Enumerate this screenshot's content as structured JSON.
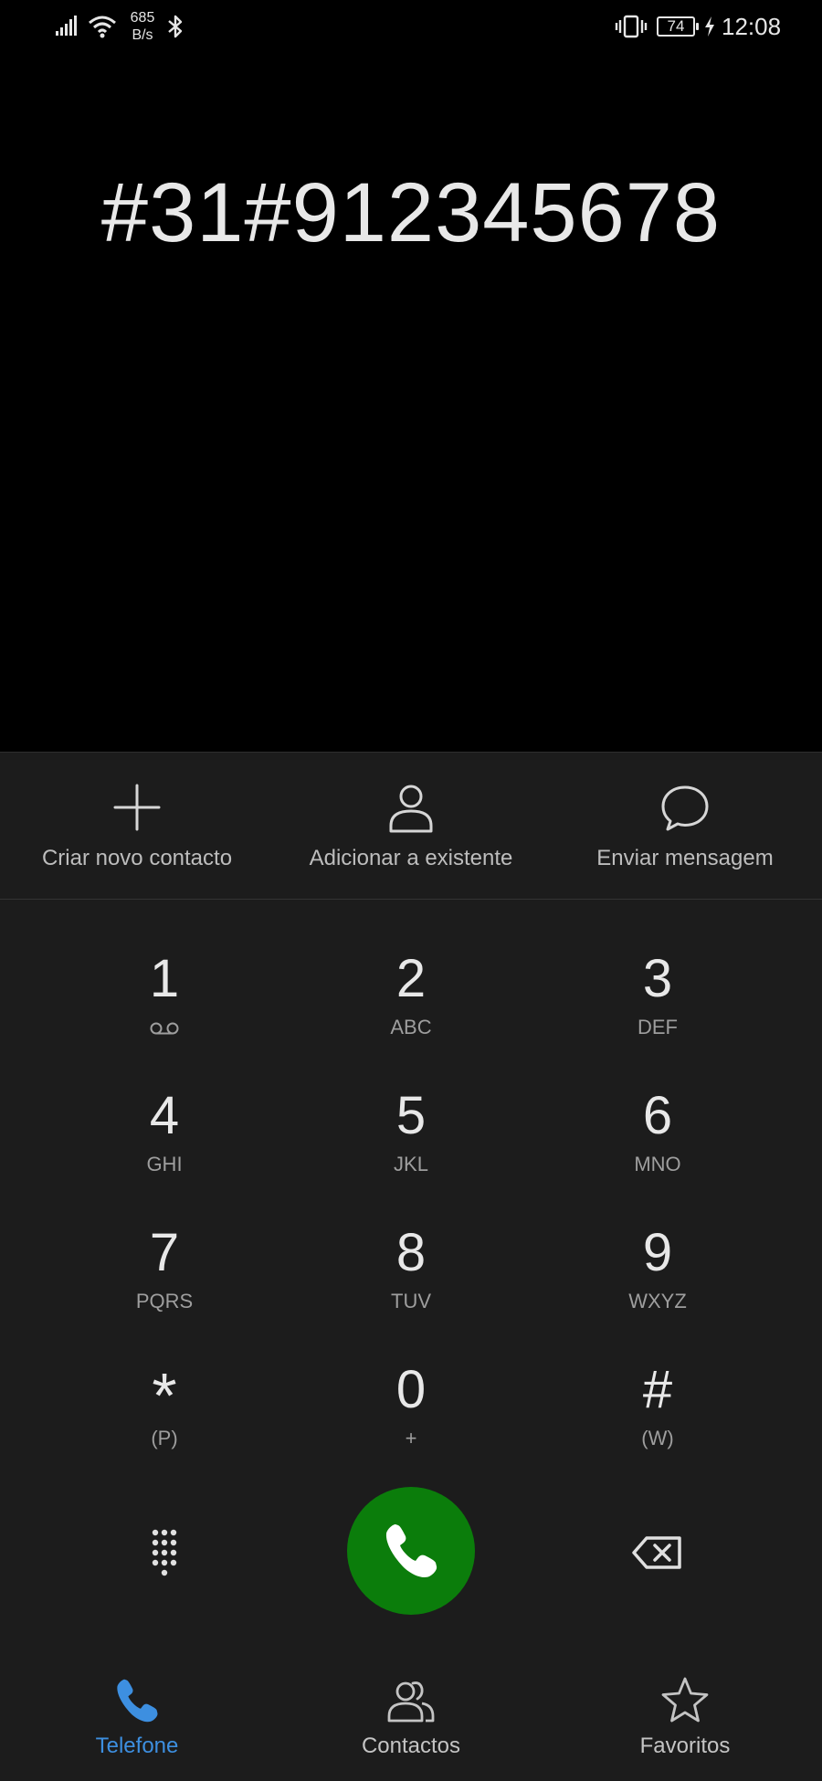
{
  "status_bar": {
    "net_speed_value": "685",
    "net_speed_unit": "B/s",
    "battery_level": "74",
    "time": "12:08"
  },
  "dialer": {
    "number": "#31#912345678"
  },
  "actions": [
    {
      "label": "Criar novo contacto",
      "icon": "plus-icon"
    },
    {
      "label": "Adicionar a existente",
      "icon": "person-icon"
    },
    {
      "label": "Enviar mensagem",
      "icon": "chat-bubble-icon"
    }
  ],
  "keypad": {
    "keys": [
      {
        "digit": "1",
        "letters": ""
      },
      {
        "digit": "2",
        "letters": "ABC"
      },
      {
        "digit": "3",
        "letters": "DEF"
      },
      {
        "digit": "4",
        "letters": "GHI"
      },
      {
        "digit": "5",
        "letters": "JKL"
      },
      {
        "digit": "6",
        "letters": "MNO"
      },
      {
        "digit": "7",
        "letters": "PQRS"
      },
      {
        "digit": "8",
        "letters": "TUV"
      },
      {
        "digit": "9",
        "letters": "WXYZ"
      },
      {
        "digit": "*",
        "letters": "(P)"
      },
      {
        "digit": "0",
        "letters": "+"
      },
      {
        "digit": "#",
        "letters": "(W)"
      }
    ]
  },
  "tabs": [
    {
      "label": "Telefone",
      "icon": "phone-icon",
      "active": true
    },
    {
      "label": "Contactos",
      "icon": "contacts-icon",
      "active": false
    },
    {
      "label": "Favoritos",
      "icon": "star-icon",
      "active": false
    }
  ],
  "colors": {
    "background": "#000000",
    "panel": "#1c1c1c",
    "call_button": "#0b7d0b",
    "active_tab": "#3d8fe0"
  }
}
